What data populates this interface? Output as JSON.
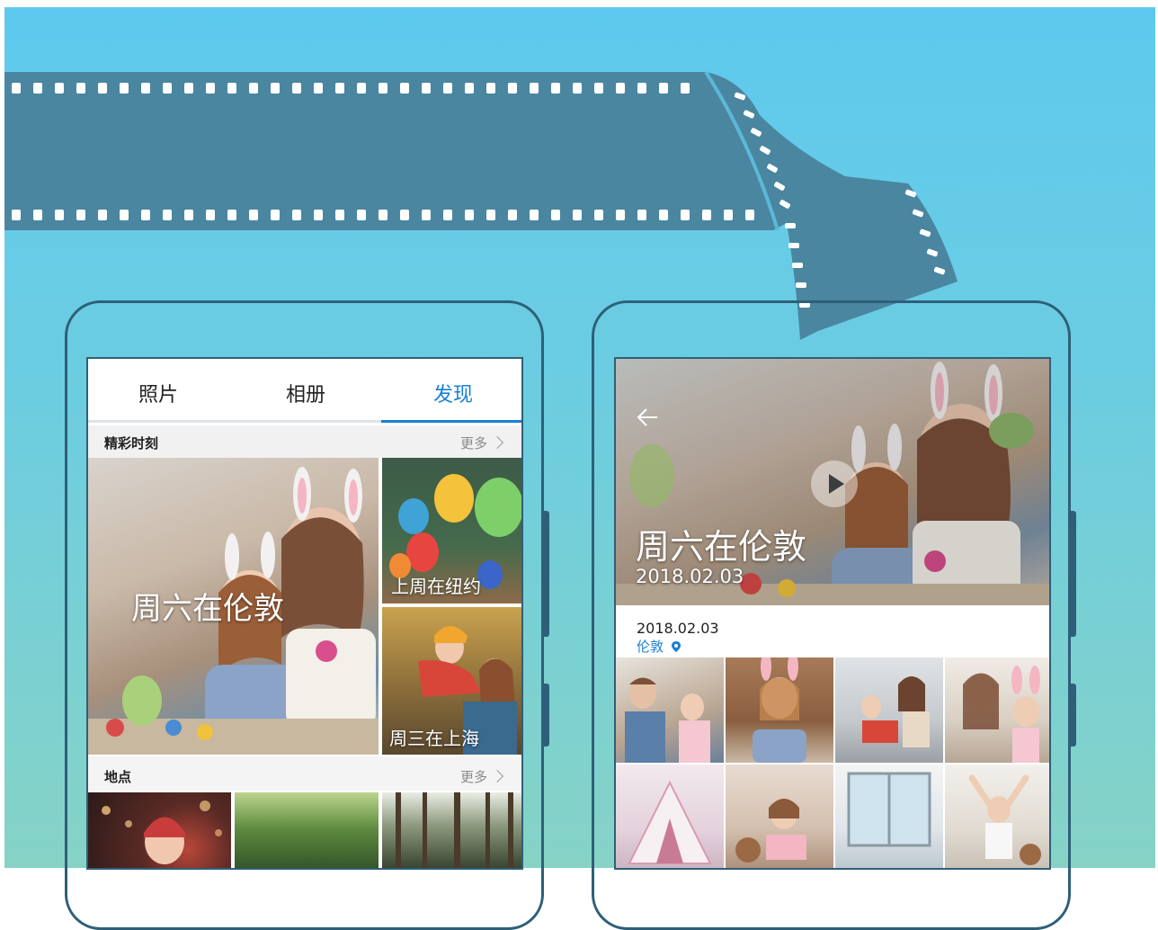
{
  "left_screen": {
    "tabs": [
      {
        "label": "照片"
      },
      {
        "label": "相册"
      },
      {
        "label": "发现"
      }
    ],
    "highlights": {
      "title": "精彩时刻",
      "more": "更多",
      "items": [
        {
          "caption": "周六在伦敦"
        },
        {
          "caption": "上周在纽约"
        },
        {
          "caption": "周三在上海"
        }
      ]
    },
    "places": {
      "title": "地点",
      "more": "更多"
    }
  },
  "right_screen": {
    "hero_title": "周六在伦敦",
    "hero_date": "2018.02.03",
    "date": "2018.02.03",
    "location": "伦敦"
  },
  "colors": {
    "accent": "#1a7fd6",
    "frame": "#2f5f78",
    "film": "#4a86a0"
  }
}
